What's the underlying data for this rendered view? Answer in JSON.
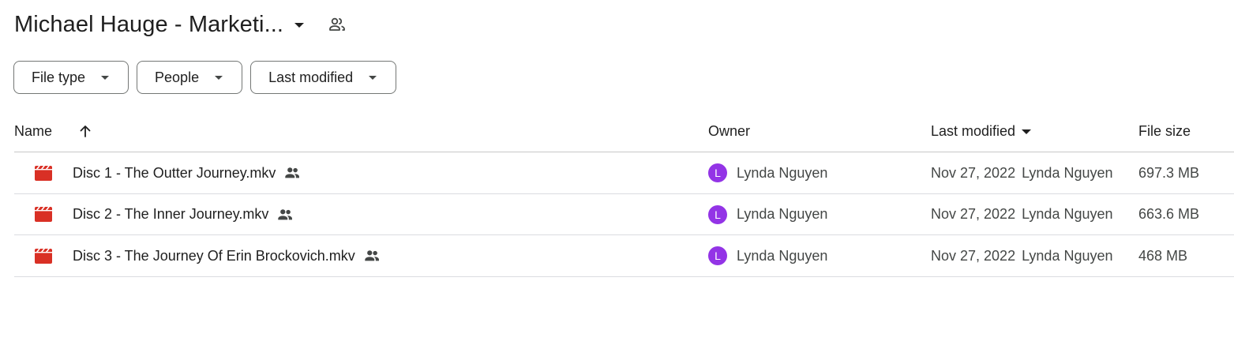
{
  "header": {
    "title": "Michael Hauge - Marketi...",
    "caret_icon": "arrow-drop-down-icon",
    "shared_icon": "shared-people-icon"
  },
  "filters": [
    {
      "label": "File type"
    },
    {
      "label": "People"
    },
    {
      "label": "Last modified"
    }
  ],
  "columns": {
    "name": "Name",
    "owner": "Owner",
    "last_modified": "Last modified",
    "file_size": "File size"
  },
  "files": [
    {
      "name": "Disc 1 - The Outter Journey.mkv",
      "owner": "Lynda Nguyen",
      "owner_initial": "L",
      "modified_date": "Nov 27, 2022",
      "modified_by": "Lynda Nguyen",
      "size": "697.3 MB"
    },
    {
      "name": "Disc 2 - The Inner Journey.mkv",
      "owner": "Lynda Nguyen",
      "owner_initial": "L",
      "modified_date": "Nov 27, 2022",
      "modified_by": "Lynda Nguyen",
      "size": "663.6 MB"
    },
    {
      "name": "Disc 3 - The Journey Of Erin Brockovich.mkv",
      "owner": "Lynda Nguyen",
      "owner_initial": "L",
      "modified_date": "Nov 27, 2022",
      "modified_by": "Lynda Nguyen",
      "size": "468 MB"
    }
  ],
  "colors": {
    "video_icon": "#d93025",
    "avatar": "#9334e6",
    "border": "#747775",
    "divider": "#dadce0"
  }
}
